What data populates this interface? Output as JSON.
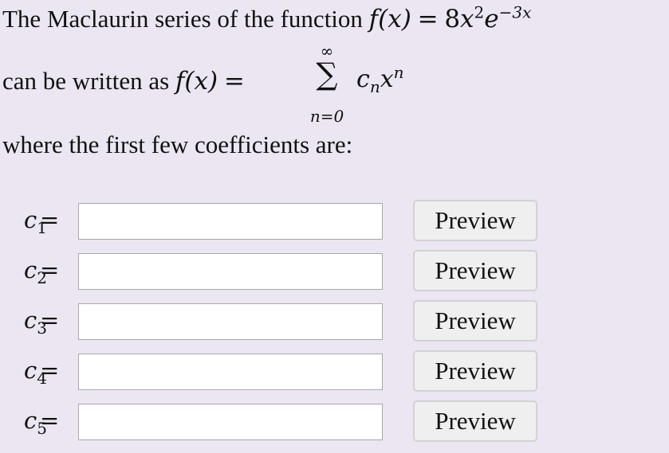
{
  "problem": {
    "line1_text": "The Maclaurin series of the function",
    "func_lhs": "f(x)",
    "eq": "=",
    "func_coef": "8",
    "func_var": "x",
    "func_pow": "2",
    "func_base": "e",
    "func_exp": "−3x",
    "line2_text": "can be written as",
    "sum_top": "∞",
    "sum_symbol": "∑",
    "sum_bottom": "n=0",
    "term_coef": "c",
    "term_coef_sub": "n",
    "term_var": "x",
    "term_pow": "n",
    "line3_text": "where the first few coefficients are:"
  },
  "answers": [
    {
      "label": "c",
      "index": "1",
      "eq": "=",
      "value": "",
      "button": "Preview"
    },
    {
      "label": "c",
      "index": "2",
      "eq": "=",
      "value": "",
      "button": "Preview"
    },
    {
      "label": "c",
      "index": "3",
      "eq": "=",
      "value": "",
      "button": "Preview"
    },
    {
      "label": "c",
      "index": "4",
      "eq": "=",
      "value": "",
      "button": "Preview"
    },
    {
      "label": "c",
      "index": "5",
      "eq": "=",
      "value": "",
      "button": "Preview"
    }
  ]
}
